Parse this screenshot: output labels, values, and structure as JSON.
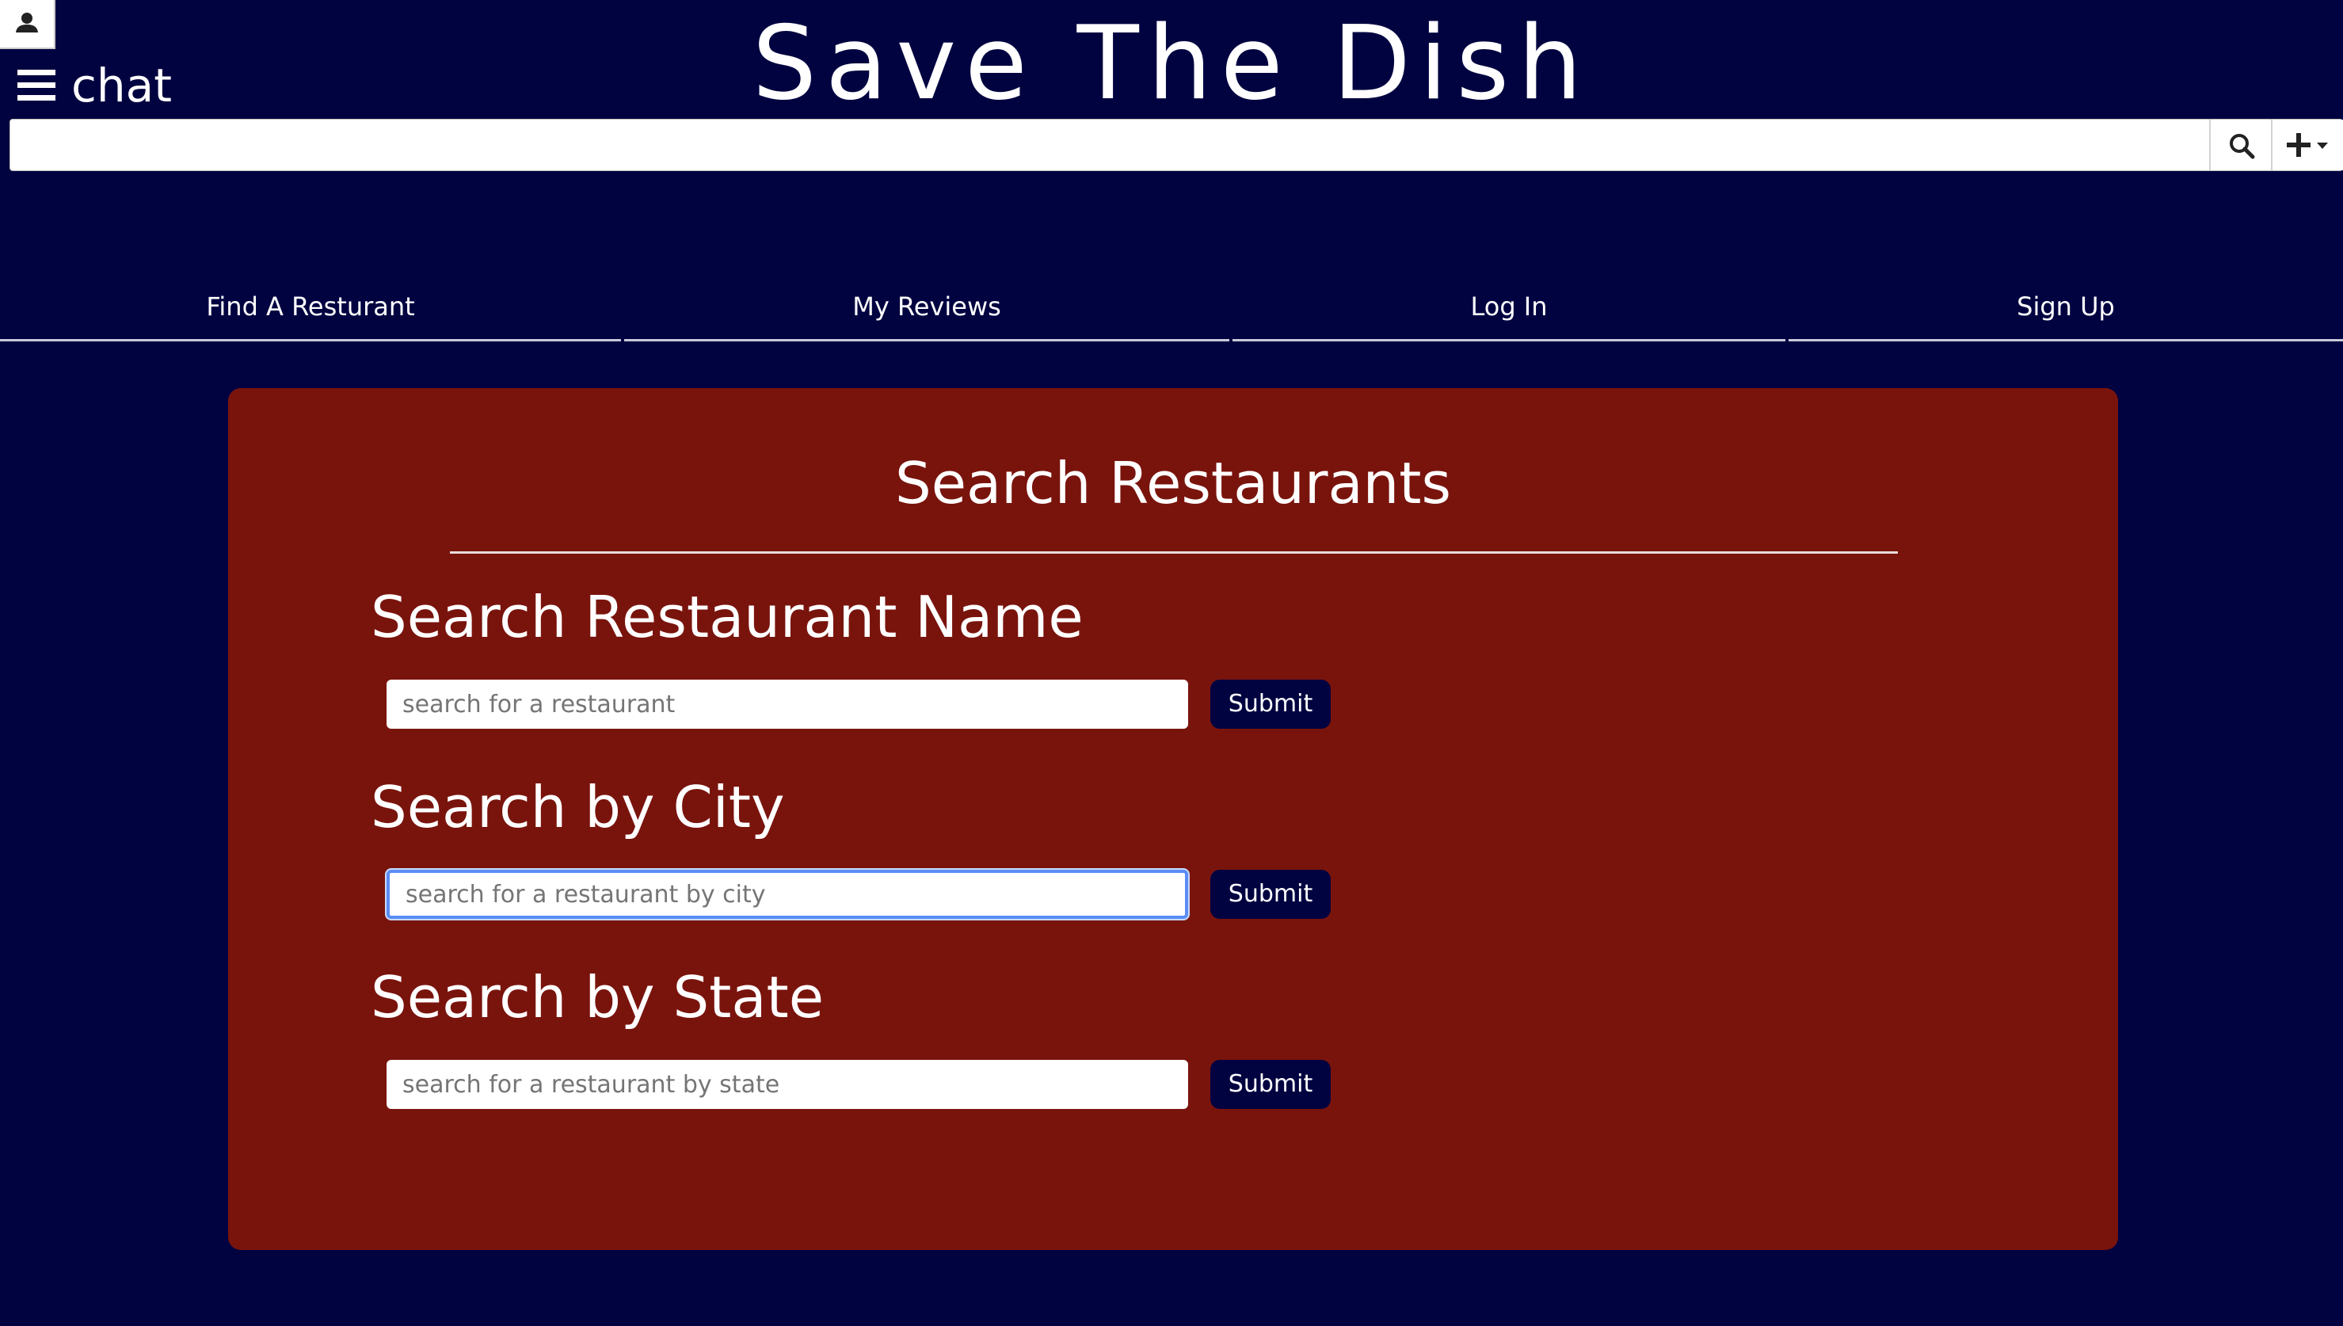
{
  "header": {
    "site_title": "Save The Dish",
    "chat_label": "chat",
    "icons": {
      "user": "user-icon",
      "menu": "hamburger-menu-icon",
      "search": "search-icon",
      "add": "plus-dropdown-icon"
    }
  },
  "searchbar": {
    "value": "",
    "placeholder": ""
  },
  "nav": {
    "items": [
      {
        "label": "Find A Resturant"
      },
      {
        "label": "My Reviews"
      },
      {
        "label": "Log In"
      },
      {
        "label": "Sign Up"
      }
    ]
  },
  "search_panel": {
    "title": "Search Restaurants",
    "sections": [
      {
        "heading": "Search Restaurant Name",
        "placeholder": "search for a restaurant",
        "value": "",
        "button": "Submit",
        "focused": false
      },
      {
        "heading": "Search by City",
        "placeholder": "search for a restaurant by city",
        "value": "",
        "button": "Submit",
        "focused": true
      },
      {
        "heading": "Search by State",
        "placeholder": "search for a restaurant by state",
        "value": "",
        "button": "Submit",
        "focused": false
      }
    ]
  },
  "colors": {
    "page_background": "#000340",
    "panel_background": "#79140d",
    "button_background": "#000340",
    "text": "#ffffff",
    "focus_ring": "#5a8cf5"
  }
}
